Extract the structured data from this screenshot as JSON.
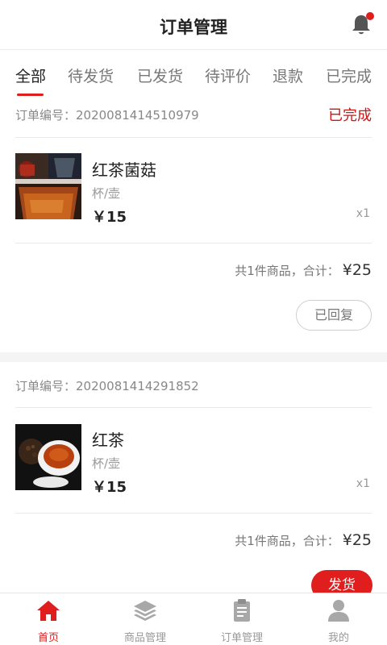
{
  "header": {
    "title": "订单管理",
    "notification_icon": "bell-icon",
    "badge_color": "#e01e1e"
  },
  "tabs": [
    {
      "label": "全部",
      "active": true
    },
    {
      "label": "待发货",
      "active": false
    },
    {
      "label": "已发货",
      "active": false
    },
    {
      "label": "待评价",
      "active": false
    },
    {
      "label": "退款",
      "active": false
    },
    {
      "label": "已完成",
      "active": false
    }
  ],
  "orders": [
    {
      "order_no": "订单编号：2020081414510979",
      "status": "已完成",
      "product": {
        "name": "红茶菌菇",
        "unit": "杯/壶",
        "price": "￥15",
        "qty": "x1"
      },
      "summary": {
        "text": "共1件商品，合计：",
        "total": "¥25"
      },
      "action": "已回复"
    },
    {
      "order_no": "订单编号：2020081414291852",
      "status": "",
      "product": {
        "name": "红茶",
        "unit": "杯/壶",
        "price": "￥15",
        "qty": "x1"
      },
      "summary": {
        "text": "共1件商品，合计：",
        "total": "¥25"
      },
      "action": "发货"
    }
  ],
  "tabbar": [
    {
      "label": "首页",
      "icon": "home-icon",
      "active": true
    },
    {
      "label": "商品管理",
      "icon": "layers-icon",
      "active": false
    },
    {
      "label": "订单管理",
      "icon": "clipboard-icon",
      "active": false
    },
    {
      "label": "我的",
      "icon": "user-icon",
      "active": false
    }
  ],
  "colors": {
    "accent": "#e01e1e",
    "status_red": "#d21414",
    "muted": "#999999"
  }
}
